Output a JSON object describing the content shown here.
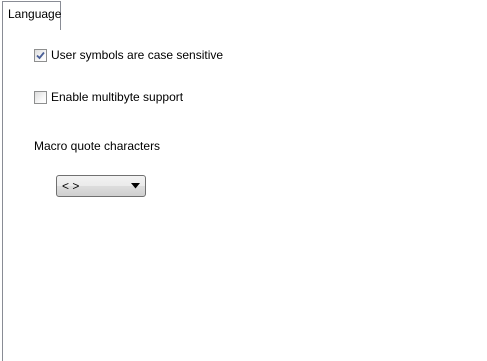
{
  "tabs": [
    {
      "label": "Language",
      "selected": true
    }
  ],
  "options": {
    "case_sensitive": {
      "label": "User symbols are case sensitive",
      "checked": true
    },
    "multibyte": {
      "label": "Enable multibyte support",
      "checked": false
    }
  },
  "macro_quote": {
    "label": "Macro quote characters",
    "selected_value": "< >"
  },
  "colors": {
    "border": "#898c95",
    "checkmark": "#4a5f97"
  }
}
